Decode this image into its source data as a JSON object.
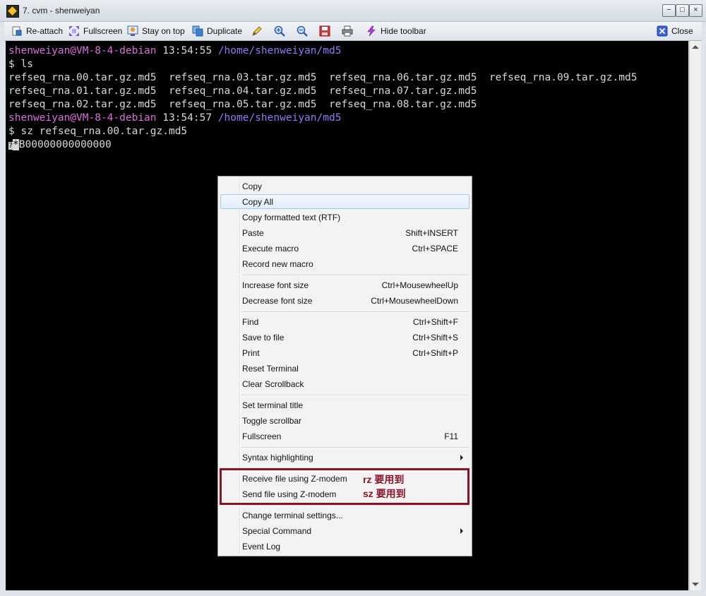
{
  "window": {
    "title": "7. cvm - shenweiyan",
    "buttons": {
      "minimize": "−",
      "maximize": "□",
      "close": "×"
    }
  },
  "toolbar": {
    "reattach": "Re-attach",
    "fullscreen": "Fullscreen",
    "stay_on_top": "Stay on top",
    "duplicate": "Duplicate",
    "hide_toolbar": "Hide toolbar",
    "close": "Close"
  },
  "terminal": {
    "line1": {
      "user": "shenweiyan@VM-8-4-debian",
      "time": "13:54:55",
      "path": "/home/shenweiyan/md5"
    },
    "line2": "$ ls",
    "line3": "refseq_rna.00.tar.gz.md5  refseq_rna.03.tar.gz.md5  refseq_rna.06.tar.gz.md5  refseq_rna.09.tar.gz.md5",
    "line4": "refseq_rna.01.tar.gz.md5  refseq_rna.04.tar.gz.md5  refseq_rna.07.tar.gz.md5",
    "line5": "refseq_rna.02.tar.gz.md5  refseq_rna.05.tar.gz.md5  refseq_rna.08.tar.gz.md5",
    "line6": {
      "user": "shenweiyan@VM-8-4-debian",
      "time": "13:54:57",
      "path": "/home/shenweiyan/md5"
    },
    "line7": "$ sz refseq_rna.00.tar.gz.md5",
    "line8_glyph1": "?",
    "line8_glyph2": "*",
    "line8_rest": "B00000000000000"
  },
  "menu": {
    "copy": "Copy",
    "copy_all": "Copy All",
    "copy_rtf": "Copy formatted text (RTF)",
    "paste": {
      "label": "Paste",
      "shortcut": "Shift+INSERT"
    },
    "execute_macro": {
      "label": "Execute macro",
      "shortcut": "Ctrl+SPACE"
    },
    "record_macro": "Record new macro",
    "increase_font": {
      "label": "Increase font size",
      "shortcut": "Ctrl+MousewheelUp"
    },
    "decrease_font": {
      "label": "Decrease font size",
      "shortcut": "Ctrl+MousewheelDown"
    },
    "find": {
      "label": "Find",
      "shortcut": "Ctrl+Shift+F"
    },
    "save_to_file": {
      "label": "Save to file",
      "shortcut": "Ctrl+Shift+S"
    },
    "print": {
      "label": "Print",
      "shortcut": "Ctrl+Shift+P"
    },
    "reset_terminal": "Reset Terminal",
    "clear_scrollback": "Clear Scrollback",
    "set_title": "Set terminal title",
    "toggle_scrollbar": "Toggle scrollbar",
    "fullscreen": {
      "label": "Fullscreen",
      "shortcut": "F11"
    },
    "syntax_highlighting": "Syntax highlighting",
    "receive_zmodem": "Receive file using Z-modem",
    "send_zmodem": "Send file using Z-modem",
    "change_settings": "Change terminal settings...",
    "special_command": "Special Command",
    "event_log": "Event Log"
  },
  "annotations": {
    "rz": "rz 要用到",
    "sz": "sz 要用到",
    "color": "#8b1328"
  }
}
